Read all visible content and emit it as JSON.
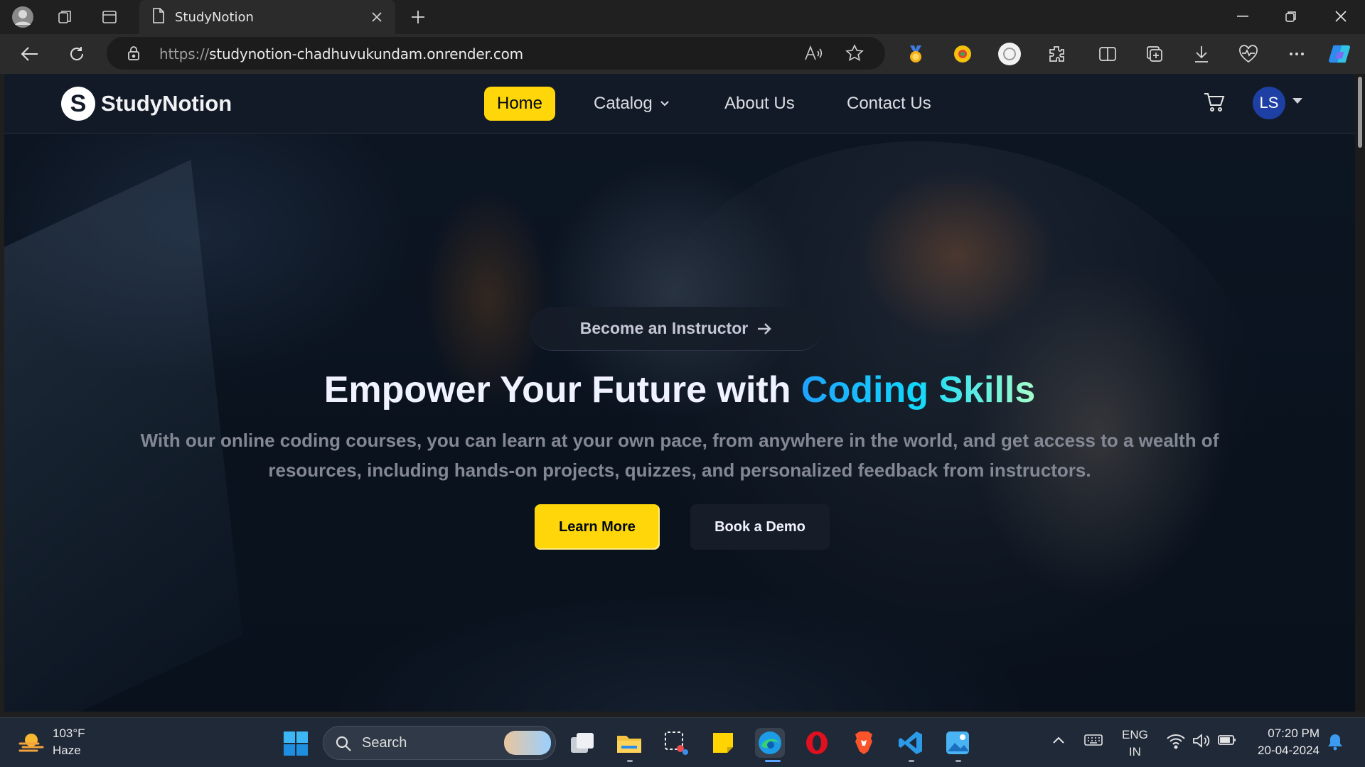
{
  "browser": {
    "tab_title": "StudyNotion",
    "url_protocol": "https://",
    "url_host": "studynotion-chadhuvukundam.onrender.com"
  },
  "site": {
    "logo_mark": "S",
    "logo_text": "StudyNotion",
    "nav": {
      "home": "Home",
      "catalog": "Catalog",
      "about": "About Us",
      "contact": "Contact Us"
    },
    "avatar_initials": "LS",
    "accent": "#ffd60a"
  },
  "hero": {
    "instructor_button": "Become an Instructor",
    "title_plain": "Empower Your Future with ",
    "title_highlight": "Coding Skills",
    "subtitle": "With our online coding courses, you can learn at your own pace, from anywhere in the world, and get access to a wealth of resources, including hands-on projects, quizzes, and personalized feedback from instructors.",
    "learn_more": "Learn More",
    "book_demo": "Book a Demo"
  },
  "taskbar": {
    "weather_temp": "103°F",
    "weather_desc": "Haze",
    "search_placeholder": "Search",
    "lang_top": "ENG",
    "lang_bottom": "IN",
    "time": "07:20 PM",
    "date": "20-04-2024"
  }
}
